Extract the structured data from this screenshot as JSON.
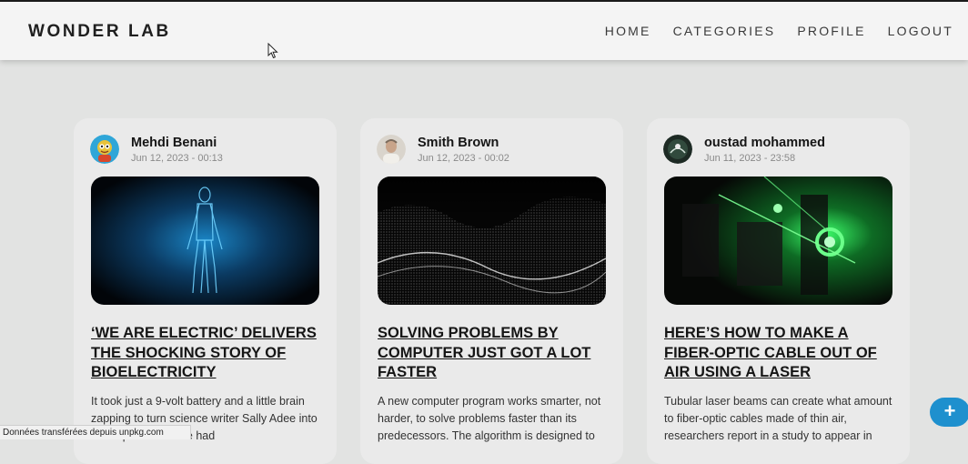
{
  "navbar": {
    "brand": "WONDER LAB",
    "links": [
      "HOME",
      "CATEGORIES",
      "PROFILE",
      "LOGOUT"
    ]
  },
  "posts": [
    {
      "author": "Mehdi Benani",
      "date": "Jun 12, 2023 - 00:13",
      "title": "‘WE ARE ELECTRIC’ DELIVERS THE SHOCKING STORY OF BIOELECTRICITY",
      "excerpt": "It took just a 9-volt battery and a little brain zapping to turn science writer Sally Adee into a sharpshooter. She had",
      "image": "glowing-human-body"
    },
    {
      "author": "Smith Brown",
      "date": "Jun 12, 2023 - 00:02",
      "title": "SOLVING PROBLEMS BY COMPUTER JUST GOT A LOT FASTER",
      "excerpt": "A new computer program works smarter, not harder, to solve problems faster than its predecessors. The algorithm is designed to",
      "image": "particle-wave"
    },
    {
      "author": "oustad mohammed",
      "date": "Jun 11, 2023 - 23:58",
      "title": "HERE’S HOW TO MAKE A FIBER-OPTIC CABLE OUT OF AIR USING A LASER",
      "excerpt": "Tubular laser beams can create what amount to fiber-optic cables made of thin air, researchers report in a study to appear in",
      "image": "green-laser-lab"
    }
  ],
  "fab": {
    "label": "+"
  },
  "statusbar": {
    "text": "Données transférées depuis unpkg.com"
  },
  "colors": {
    "accent": "#1e90ce",
    "background": "#e2e3e2",
    "card": "#eaeaea"
  }
}
